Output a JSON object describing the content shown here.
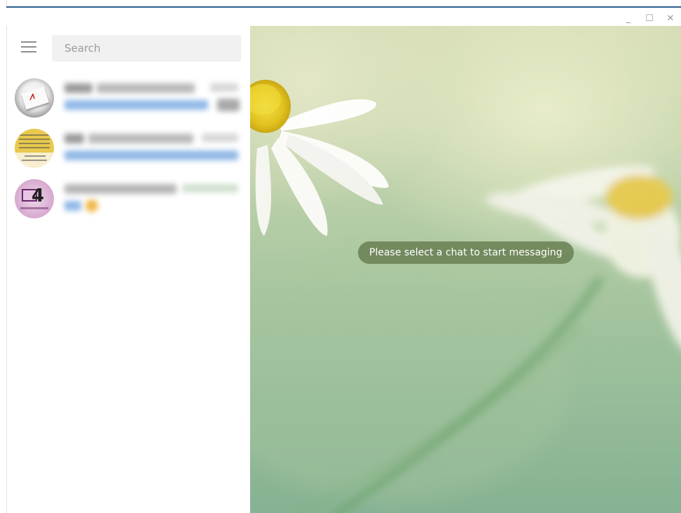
{
  "window": {
    "controls": {
      "minimize": "_",
      "maximize": "☐",
      "close": "✕"
    }
  },
  "sidebar": {
    "search": {
      "placeholder": "Search",
      "value": ""
    },
    "chats": [
      {
        "avatar": "red-logo-card-avatar"
      },
      {
        "avatar": "yellow-notice-avatar"
      },
      {
        "avatar": "e24-logo-avatar"
      }
    ]
  },
  "main": {
    "empty_message": "Please select a chat to start messaging",
    "background": "chamomile-flowers-wallpaper"
  },
  "colors": {
    "title_accent": "#2b5a8c",
    "bubble_bg": "#62784a",
    "blurred_link": "#8fb8e6"
  }
}
